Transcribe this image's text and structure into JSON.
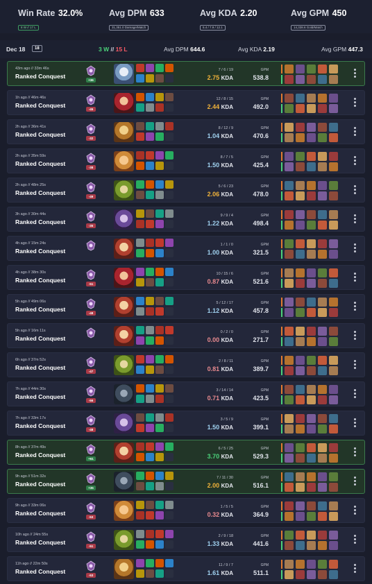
{
  "stats": [
    {
      "label": "Win Rate",
      "value": "32.0%",
      "sub": "8 W // 17 L",
      "sub_color": "green"
    },
    {
      "label": "Avg DPM",
      "value": "633",
      "sub": "31,351.0 Damage/Match",
      "sub_color": "gray"
    },
    {
      "label": "Avg KDA",
      "value": "2.20",
      "sub": "5.4 / 7.9 / 12.1",
      "sub_color": "gray"
    },
    {
      "label": "Avg GPM",
      "value": "450",
      "sub": "14,338.6 Gold/Match",
      "sub_color": "gray"
    }
  ],
  "day": {
    "date": "Dec 18",
    "count": "18",
    "wins": "3 W",
    "sep": "//",
    "losses": "15 L",
    "dpm_label": "Avg DPM",
    "dpm": "644.6",
    "kda_label": "Avg KDA",
    "kda": "2.19",
    "gpm_label": "Avg GPM",
    "gpm": "447.3"
  },
  "colors": {
    "win": "#4bd27a",
    "loss": "#ff5b66",
    "kda_gold": "#f0b23a",
    "kda_blue": "#9fd0ee",
    "kda_red": "#e88a8f",
    "kda_green": "#4bd27a"
  },
  "matches": [
    {
      "time": "43m ago // 33m 46s",
      "mode": "Ranked Conquest",
      "win": true,
      "tp": "+36",
      "god": "frost",
      "kd": "7 / 6 / 19",
      "kda": "2.75",
      "kda_color": "gold",
      "gpm_label": "GPM",
      "gpm": "538.8"
    },
    {
      "time": "1h ago // 46m 46s",
      "mode": "Ranked Conquest",
      "win": false,
      "tp": "-45",
      "god": "crimson",
      "kd": "12 / 8 / 15",
      "kda": "2.44",
      "kda_color": "gold",
      "gpm_label": "GPM",
      "gpm": "492.0"
    },
    {
      "time": "2h ago // 36m 41s",
      "mode": "Ranked Conquest",
      "win": false,
      "tp": "-32",
      "god": "golden",
      "kd": "8 / 12 / 9",
      "kda": "1.04",
      "kda_color": "blue",
      "gpm_label": "GPM",
      "gpm": "470.6"
    },
    {
      "time": "2h ago // 35m 59s",
      "mode": "Ranked Conquest",
      "win": false,
      "tp": "-38",
      "god": "sun",
      "kd": "8 / 7 / 5",
      "kda": "1.50",
      "kda_color": "blue",
      "gpm_label": "GPM",
      "gpm": "425.4"
    },
    {
      "time": "2h ago // 48m 25s",
      "mode": "Ranked Conquest",
      "win": false,
      "tp": "-49",
      "god": "green",
      "kd": "5 / 6 / 23",
      "kda": "2.06",
      "kda_color": "gold",
      "gpm_label": "GPM",
      "gpm": "478.0"
    },
    {
      "time": "3h ago // 30m 44s",
      "mode": "Ranked Conquest",
      "win": false,
      "tp": "-35",
      "god": "violet",
      "kd": "9 / 9 / 4",
      "kda": "1.22",
      "kda_color": "blue",
      "gpm_label": "GPM",
      "gpm": "498.4"
    },
    {
      "time": "4h ago // 15m 24s",
      "mode": "Ranked Conquest",
      "win": false,
      "tp": "",
      "god": "warrior",
      "kd": "1 / 1 / 0",
      "kda": "1.00",
      "kda_color": "blue",
      "gpm_label": "GPM",
      "gpm": "321.5"
    },
    {
      "time": "4h ago // 38m 30s",
      "mode": "Ranked Conquest",
      "win": false,
      "tp": "-51",
      "god": "crimson",
      "kd": "10 / 15 / 6",
      "kda": "0.87",
      "kda_color": "red",
      "gpm_label": "GPM",
      "gpm": "521.6"
    },
    {
      "time": "5h ago // 49m 06s",
      "mode": "Ranked Conquest",
      "win": false,
      "tp": "-48",
      "god": "warrior",
      "kd": "5 / 12 / 17",
      "kda": "1.12",
      "kda_color": "blue",
      "gpm_label": "GPM",
      "gpm": "457.8"
    },
    {
      "time": "5h ago // 16m 11s",
      "mode": "Ranked Conquest",
      "win": false,
      "tp": "",
      "god": "warrior",
      "kd": "0 / 2 / 0",
      "kda": "0.00",
      "kda_color": "red",
      "gpm_label": "GPM",
      "gpm": "271.7"
    },
    {
      "time": "6h ago // 37m 52s",
      "mode": "Ranked Conquest",
      "win": false,
      "tp": "-47",
      "god": "green",
      "kd": "2 / 8 / 11",
      "kda": "0.81",
      "kda_color": "red",
      "gpm_label": "GPM",
      "gpm": "389.7"
    },
    {
      "time": "7h ago // 44m 30s",
      "mode": "Ranked Conquest",
      "win": false,
      "tp": "-56",
      "god": "dark",
      "kd": "3 / 14 / 14",
      "kda": "0.71",
      "kda_color": "red",
      "gpm_label": "GPM",
      "gpm": "423.5"
    },
    {
      "time": "7h ago // 33m 17s",
      "mode": "Ranked Conquest",
      "win": false,
      "tp": "-48",
      "god": "violet",
      "kd": "3 / 5 / 9",
      "kda": "1.50",
      "kda_color": "blue",
      "gpm_label": "GPM",
      "gpm": "399.1"
    },
    {
      "time": "8h ago // 37m 49s",
      "mode": "Ranked Conquest",
      "win": true,
      "tp": "+61",
      "god": "warrior",
      "kd": "6 / 5 / 25",
      "kda": "3.70",
      "kda_color": "green",
      "gpm_label": "GPM",
      "gpm": "529.3"
    },
    {
      "time": "9h ago // 51m 32s",
      "mode": "Ranked Conquest",
      "win": true,
      "tp": "+35",
      "god": "dark",
      "kd": "7 / 11 / 30",
      "kda": "2.00",
      "kda_color": "gold",
      "gpm_label": "GPM",
      "gpm": "516.1"
    },
    {
      "time": "9h ago // 33m 06s",
      "mode": "Ranked Conquest",
      "win": false,
      "tp": "-53",
      "god": "sun",
      "kd": "1 / 5 / 5",
      "kda": "0.32",
      "kda_color": "red",
      "gpm_label": "GPM",
      "gpm": "364.9"
    },
    {
      "time": "10h ago // 24m 55s",
      "mode": "Ranked Conquest",
      "win": false,
      "tp": "-51",
      "god": "green",
      "kd": "2 / 9 / 18",
      "kda": "1.33",
      "kda_color": "blue",
      "gpm_label": "GPM",
      "gpm": "441.6"
    },
    {
      "time": "11h ago // 22m 50s",
      "mode": "Ranked Conquest",
      "win": false,
      "tp": "-53",
      "god": "golden",
      "kd": "11 / 9 / 7",
      "kda": "1.61",
      "kda_color": "blue",
      "gpm_label": "GPM",
      "gpm": "511.1"
    }
  ],
  "kda_suffix": "KDA"
}
